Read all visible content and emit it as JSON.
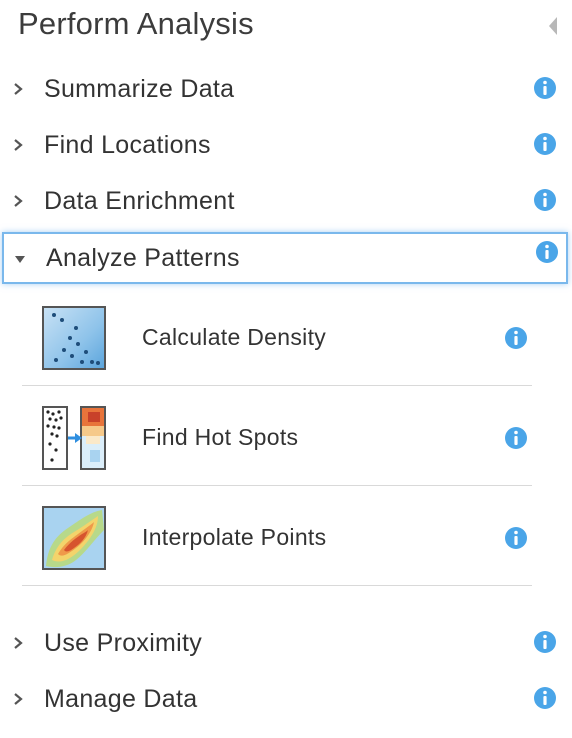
{
  "panel": {
    "title": "Perform Analysis"
  },
  "colors": {
    "info_blue": "#4aa5e8",
    "chevron": "#555555",
    "focus_border": "#7ab8ec",
    "divider": "#d9d9d9"
  },
  "categories": [
    {
      "label": "Summarize Data",
      "expanded": false,
      "icon": "info-icon"
    },
    {
      "label": "Find Locations",
      "expanded": false,
      "icon": "info-icon"
    },
    {
      "label": "Data Enrichment",
      "expanded": false,
      "icon": "info-icon"
    },
    {
      "label": "Analyze Patterns",
      "expanded": true,
      "icon": "info-icon"
    },
    {
      "label": "Use Proximity",
      "expanded": false,
      "icon": "info-icon"
    },
    {
      "label": "Manage Data",
      "expanded": false,
      "icon": "info-icon"
    }
  ],
  "tools": [
    {
      "label": "Calculate Density",
      "thumbnail": "density-thumbnail",
      "icon": "info-icon"
    },
    {
      "label": "Find Hot Spots",
      "thumbnail": "hot-spots-thumbnail",
      "icon": "info-icon"
    },
    {
      "label": "Interpolate Points",
      "thumbnail": "interpolate-thumbnail",
      "icon": "info-icon"
    }
  ]
}
